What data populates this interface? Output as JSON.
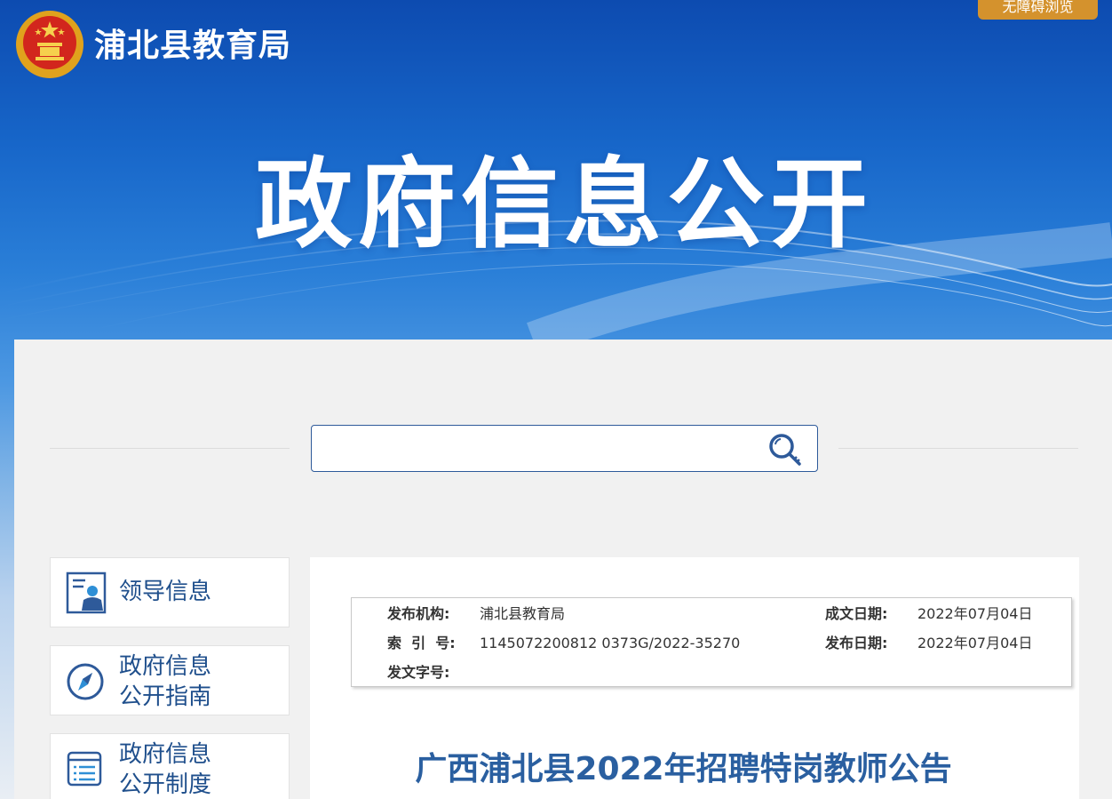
{
  "header": {
    "site_name": "浦北县教育局",
    "accessibility_label": "无障碍浏览",
    "hero_title": "政府信息公开"
  },
  "search": {
    "placeholder": "",
    "value": ""
  },
  "sidebar": {
    "items": [
      {
        "label": "领导信息",
        "icon": "leader-info-icon"
      },
      {
        "label_line1": "政府信息",
        "label_line2": "公开指南",
        "icon": "compass-icon"
      },
      {
        "label_line1": "政府信息",
        "label_line2": "公开制度",
        "icon": "document-list-icon"
      }
    ]
  },
  "article": {
    "meta": {
      "publisher_key": "发布机构:",
      "publisher_value": "浦北县教育局",
      "created_key": "成文日期:",
      "created_value": "2022年07月04日",
      "index_key": "索  引  号:",
      "index_value": "1145072200812 0373G/2022-35270",
      "published_key": "发布日期:",
      "published_value": "2022年07月04日",
      "doc_no_key": "发文字号:",
      "doc_no_value": ""
    },
    "title": "广西浦北县2022年招聘特岗教师公告"
  },
  "colors": {
    "brand_blue": "#1f4f8c",
    "title_blue": "#2a5fa0",
    "accessibility_orange": "#d4922d",
    "banner_top": "#0d4bb0"
  }
}
